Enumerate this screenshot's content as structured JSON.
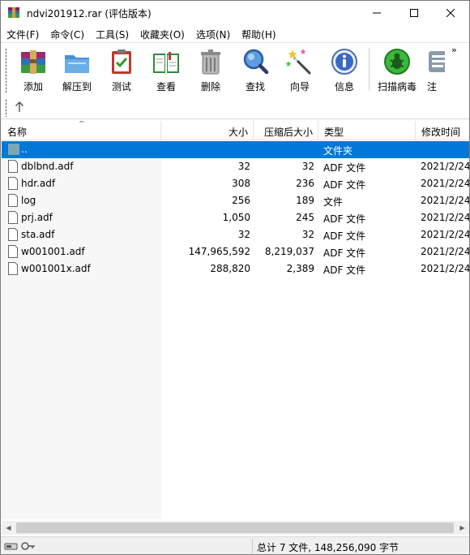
{
  "window": {
    "title": "ndvi201912.rar (评估版本)"
  },
  "menu": [
    {
      "label": "文件(F)"
    },
    {
      "label": "命令(C)"
    },
    {
      "label": "工具(S)"
    },
    {
      "label": "收藏夹(O)"
    },
    {
      "label": "选项(N)"
    },
    {
      "label": "帮助(H)"
    }
  ],
  "toolbar": [
    {
      "label": "添加",
      "icon": "add-archive-icon"
    },
    {
      "label": "解压到",
      "icon": "extract-to-icon"
    },
    {
      "label": "测试",
      "icon": "test-clipboard-icon"
    },
    {
      "label": "查看",
      "icon": "view-book-icon"
    },
    {
      "label": "删除",
      "icon": "trash-can-icon"
    },
    {
      "label": "查找",
      "icon": "magnifier-icon"
    },
    {
      "label": "向导",
      "icon": "magic-wand-icon"
    },
    {
      "label": "信息",
      "icon": "info-icon"
    },
    {
      "label": "扫描病毒",
      "icon": "virus-scan-icon"
    },
    {
      "label": "注",
      "icon": "comment-icon"
    }
  ],
  "columns": {
    "name": "名称",
    "size": "大小",
    "packed": "压缩后大小",
    "type": "类型",
    "mtime": "修改时间"
  },
  "rows": [
    {
      "name": "..",
      "size": "",
      "packed": "",
      "type": "文件夹",
      "mtime": "",
      "selected": true
    },
    {
      "name": "dblbnd.adf",
      "size": "32",
      "packed": "32",
      "type": "ADF 文件",
      "mtime": "2021/2/24"
    },
    {
      "name": "hdr.adf",
      "size": "308",
      "packed": "236",
      "type": "ADF 文件",
      "mtime": "2021/2/24"
    },
    {
      "name": "log",
      "size": "256",
      "packed": "189",
      "type": "文件",
      "mtime": "2021/2/24"
    },
    {
      "name": "prj.adf",
      "size": "1,050",
      "packed": "245",
      "type": "ADF 文件",
      "mtime": "2021/2/24"
    },
    {
      "name": "sta.adf",
      "size": "32",
      "packed": "32",
      "type": "ADF 文件",
      "mtime": "2021/2/24"
    },
    {
      "name": "w001001.adf",
      "size": "147,965,592",
      "packed": "8,219,037",
      "type": "ADF 文件",
      "mtime": "2021/2/24"
    },
    {
      "name": "w001001x.adf",
      "size": "288,820",
      "packed": "2,389",
      "type": "ADF 文件",
      "mtime": "2021/2/24"
    }
  ],
  "status": {
    "summary": "总计 7 文件, 148,256,090 字节"
  },
  "colors": {
    "selection": "#0078d7",
    "folder": "#7aa6b8"
  }
}
